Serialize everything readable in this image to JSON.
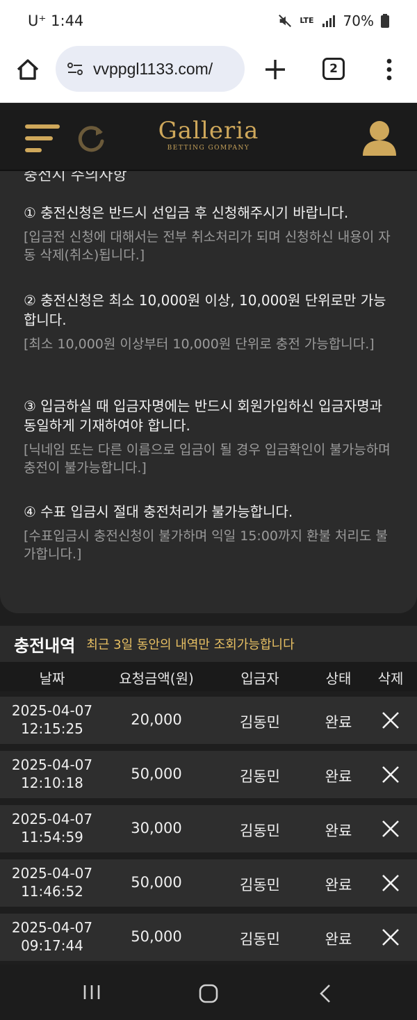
{
  "status_bar": {
    "carrier_time": "U⁺ 1:44",
    "network": "LTE",
    "battery": "70%"
  },
  "browser": {
    "url": "vvppgl1133.com/",
    "tab_count": "2"
  },
  "site": {
    "logo_main": "Galleria",
    "logo_sub": "BETTING GOMPANY"
  },
  "notice": {
    "cut_heading": "충전시 주의사항",
    "items": [
      {
        "main": "① 충전신청은 반드시 선입금 후 신청해주시기 바랍니다.",
        "sub": "[입금전 신청에 대해서는 전부 취소처리가 되며 신청하신 내용이 자동 삭제(취소)됩니다.]"
      },
      {
        "main": "② 충전신청은 최소 10,000원 이상, 10,000원 단위로만 가능합니다.",
        "sub": "[최소 10,000원 이상부터 10,000원 단위로 충전 가능합니다.]"
      },
      {
        "main": "③ 입금하실 때 입금자명에는 반드시 회원가입하신 입금자명과 동일하게 기재하여야 합니다.",
        "sub": "[닉네임 또는 다른 이름으로 입금이 될 경우 입금확인이 불가능하며 충전이 불가능합니다.]"
      },
      {
        "main": "④ 수표 입금시 절대 충전처리가 불가능합니다.",
        "sub": "[수표입금시 충전신청이 불가하며 익일 15:00까지 환불 처리도 불가합니다.]"
      }
    ]
  },
  "history": {
    "title": "충전내역",
    "note": "최근 3일 동안의 내역만 조회가능합니다",
    "columns": {
      "date": "날짜",
      "amount": "요청금액(원)",
      "depositor": "입금자",
      "status": "상태",
      "delete": "삭제"
    },
    "rows": [
      {
        "date": "2025-04-07",
        "time": "12:15:25",
        "amount": "20,000",
        "depositor": "김동민",
        "status": "완료"
      },
      {
        "date": "2025-04-07",
        "time": "12:10:18",
        "amount": "50,000",
        "depositor": "김동민",
        "status": "완료"
      },
      {
        "date": "2025-04-07",
        "time": "11:54:59",
        "amount": "30,000",
        "depositor": "김동민",
        "status": "완료"
      },
      {
        "date": "2025-04-07",
        "time": "11:46:52",
        "amount": "50,000",
        "depositor": "김동민",
        "status": "완료"
      },
      {
        "date": "2025-04-07",
        "time": "09:17:44",
        "amount": "50,000",
        "depositor": "김동민",
        "status": "완료"
      }
    ]
  },
  "colors": {
    "accent_gold": "#cfa85b",
    "note_yellow": "#e8c063",
    "panel": "#2b2b2b",
    "background": "#1e1e1e"
  }
}
